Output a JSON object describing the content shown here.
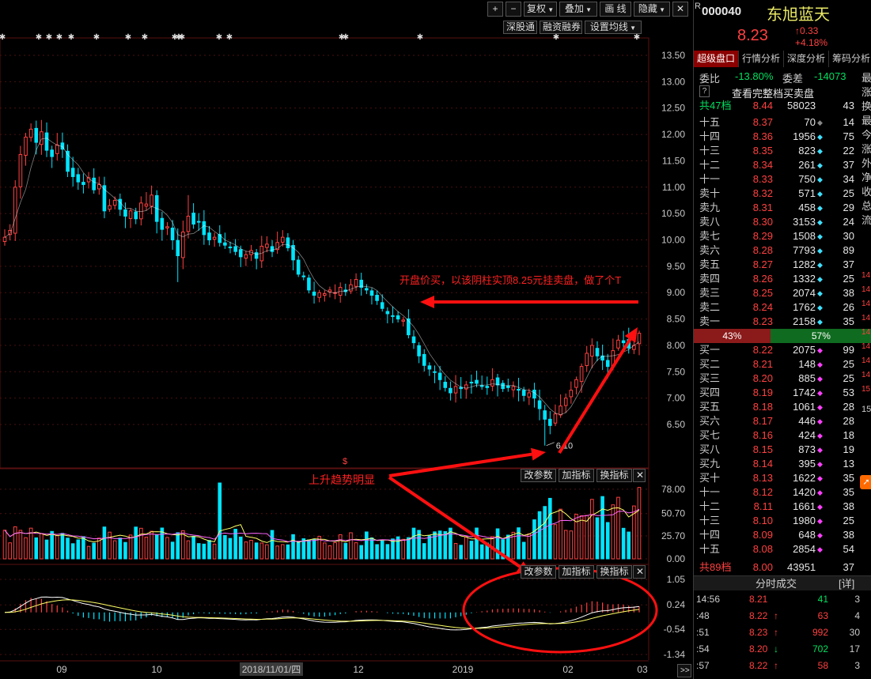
{
  "toolbar": {
    "plus": "+",
    "minus": "−",
    "restore": "复权",
    "overlay": "叠加",
    "draw": "画 线",
    "hide": "隐藏",
    "close": "✕",
    "sgt": "深股通",
    "margin": "融资融券",
    "ma_settings": "设置均线"
  },
  "markers": {
    "star_label": "✱",
    "dollar": "$"
  },
  "chart_data": [
    {
      "type": "candlestick",
      "y_ticks": [
        "13.50",
        "13.00",
        "12.50",
        "12.00",
        "11.50",
        "11.00",
        "10.50",
        "10.00",
        "9.50",
        "9.00",
        "8.50",
        "8.00",
        "7.50",
        "7.00",
        "6.50"
      ],
      "ylim": [
        6.1,
        13.5
      ],
      "low_label": "6.10",
      "x_ticks": [
        "09",
        "10",
        "2018/11/01/四",
        "12",
        "2019",
        "02",
        "03"
      ],
      "series": [
        {
          "name": "daily",
          "values": [
            10.05,
            10.18,
            11.0,
            11.62,
            11.95,
            12.1,
            11.85,
            12.05,
            11.7,
            11.58,
            11.8,
            11.72,
            11.3,
            11.2,
            11.1,
            11.05,
            11.18,
            10.95,
            11.05,
            10.55,
            10.65,
            10.75,
            10.58,
            10.45,
            10.55,
            10.4,
            10.7,
            10.68,
            10.85,
            10.35,
            10.2,
            10.25,
            10.0,
            9.7,
            10.15,
            10.45,
            10.3,
            10.35,
            10.1,
            10.0,
            10.05,
            9.95,
            9.9,
            9.85,
            9.78,
            9.68,
            9.72,
            9.8,
            9.65,
            9.88,
            9.92,
            9.78,
            9.95,
            10.05,
            9.85,
            9.62,
            9.35,
            9.3,
            9.05,
            8.95,
            9.0,
            8.98,
            9.05,
            9.0,
            9.1,
            9.02,
            9.15,
            9.25,
            9.1,
            9.05,
            8.95,
            8.85,
            8.7,
            8.6,
            8.55,
            8.5,
            8.48,
            8.2,
            8.05,
            7.8,
            7.62,
            7.55,
            7.5,
            7.35,
            7.2,
            7.1,
            7.22,
            7.18,
            7.25,
            7.3,
            7.28,
            7.22,
            7.2,
            7.35,
            7.25,
            7.18,
            7.2,
            7.22,
            7.15,
            7.05,
            7.1,
            7.0,
            6.8,
            6.6,
            6.48,
            6.7,
            6.85,
            7.0,
            7.15,
            7.35,
            7.6,
            7.85,
            8.0,
            7.8,
            7.72,
            7.6,
            7.9,
            8.1,
            8.05,
            7.95,
            8.0,
            8.23
          ]
        }
      ]
    },
    {
      "type": "bar",
      "y_ticks": [
        "78.00",
        "50.70",
        "25.70",
        "0.00"
      ],
      "ylim": [
        0,
        85
      ]
    },
    {
      "type": "bar",
      "y_ticks": [
        "1.05",
        "0.24",
        "-0.54",
        "-1.34"
      ],
      "ylim": [
        -1.34,
        1.05
      ]
    }
  ],
  "annotations": {
    "note_t": "开盘价买，以该阴柱实顶8.25元挂卖盘，做了个T",
    "trend": "上升趋势明显"
  },
  "subpanel_buttons": {
    "params": "改参数",
    "add": "加指标",
    "swap": "换指标",
    "close": "✕"
  },
  "nav": {
    "scroll_right": ">>"
  },
  "quote": {
    "code": "000040",
    "r_mark": "R",
    "name": "东旭蓝天",
    "price": "8.23",
    "change": "↑0.33",
    "pct": "+4.18%"
  },
  "tabs": [
    "超级盘口",
    "行情分析",
    "深度分析",
    "筹码分析"
  ],
  "weibi": {
    "label": "委比",
    "ratio": "-13.80%",
    "diff_label": "委差",
    "diff": "-14073"
  },
  "full_book": {
    "help": "?",
    "label": "查看完整档买卖盘"
  },
  "asks_total": {
    "label": "共47档",
    "price": "8.44",
    "vol": "58023",
    "cnt": "43"
  },
  "asks": [
    {
      "label": "十五",
      "price": "8.37",
      "vol": "70",
      "cnt": "14"
    },
    {
      "label": "十四",
      "price": "8.36",
      "vol": "1956",
      "cnt": "75"
    },
    {
      "label": "十三",
      "price": "8.35",
      "vol": "823",
      "cnt": "22"
    },
    {
      "label": "十二",
      "price": "8.34",
      "vol": "261",
      "cnt": "37"
    },
    {
      "label": "十一",
      "price": "8.33",
      "vol": "750",
      "cnt": "34"
    },
    {
      "label": "卖十",
      "price": "8.32",
      "vol": "571",
      "cnt": "25"
    },
    {
      "label": "卖九",
      "price": "8.31",
      "vol": "458",
      "cnt": "29"
    },
    {
      "label": "卖八",
      "price": "8.30",
      "vol": "3153",
      "cnt": "24"
    },
    {
      "label": "卖七",
      "price": "8.29",
      "vol": "1508",
      "cnt": "30"
    },
    {
      "label": "卖六",
      "price": "8.28",
      "vol": "7793",
      "cnt": "89"
    },
    {
      "label": "卖五",
      "price": "8.27",
      "vol": "1282",
      "cnt": "37"
    },
    {
      "label": "卖四",
      "price": "8.26",
      "vol": "1332",
      "cnt": "25"
    },
    {
      "label": "卖三",
      "price": "8.25",
      "vol": "2074",
      "cnt": "38"
    },
    {
      "label": "卖二",
      "price": "8.24",
      "vol": "1762",
      "cnt": "26"
    },
    {
      "label": "卖一",
      "price": "8.23",
      "vol": "2158",
      "cnt": "35"
    }
  ],
  "ratio_bar": {
    "left": "43%",
    "right": "57%"
  },
  "bids": [
    {
      "label": "买一",
      "price": "8.22",
      "vol": "2075",
      "cnt": "99"
    },
    {
      "label": "买二",
      "price": "8.21",
      "vol": "148",
      "cnt": "25"
    },
    {
      "label": "买三",
      "price": "8.20",
      "vol": "885",
      "cnt": "25"
    },
    {
      "label": "买四",
      "price": "8.19",
      "vol": "1742",
      "cnt": "53"
    },
    {
      "label": "买五",
      "price": "8.18",
      "vol": "1061",
      "cnt": "28"
    },
    {
      "label": "买六",
      "price": "8.17",
      "vol": "446",
      "cnt": "28"
    },
    {
      "label": "买七",
      "price": "8.16",
      "vol": "424",
      "cnt": "18"
    },
    {
      "label": "买八",
      "price": "8.15",
      "vol": "873",
      "cnt": "19"
    },
    {
      "label": "买九",
      "price": "8.14",
      "vol": "395",
      "cnt": "13"
    },
    {
      "label": "买十",
      "price": "8.13",
      "vol": "1622",
      "cnt": "35"
    },
    {
      "label": "十一",
      "price": "8.12",
      "vol": "1420",
      "cnt": "35"
    },
    {
      "label": "十二",
      "price": "8.11",
      "vol": "1661",
      "cnt": "38"
    },
    {
      "label": "十三",
      "price": "8.10",
      "vol": "1980",
      "cnt": "25"
    },
    {
      "label": "十四",
      "price": "8.09",
      "vol": "648",
      "cnt": "38"
    },
    {
      "label": "十五",
      "price": "8.08",
      "vol": "2854",
      "cnt": "54"
    }
  ],
  "bids_total": {
    "label": "共89档",
    "price": "8.00",
    "vol": "43951",
    "cnt": "37"
  },
  "trades_header": {
    "label": "分时成交",
    "detail": "[详]"
  },
  "trades": [
    {
      "time": "14:56",
      "price": "8.21",
      "arrow": "",
      "vol": "41",
      "cnt": "3"
    },
    {
      "time": ":48",
      "price": "8.22",
      "arrow": "↑",
      "vol": "63",
      "cnt": "4"
    },
    {
      "time": ":51",
      "price": "8.23",
      "arrow": "↑",
      "vol": "992",
      "cnt": "30"
    },
    {
      "time": ":54",
      "price": "8.20",
      "arrow": "↓",
      "vol": "702",
      "cnt": "17"
    },
    {
      "time": ":57",
      "price": "8.22",
      "arrow": "↑",
      "vol": "58",
      "cnt": "3"
    }
  ],
  "edge_labels": [
    "最",
    "涨",
    "换",
    "最",
    "今",
    "涨",
    "外",
    "净",
    "收",
    "总",
    "流"
  ],
  "edge_nums": [
    "14",
    "14",
    "14",
    "14",
    "14",
    "14",
    "14",
    "14",
    "15"
  ],
  "edge_vol": "15",
  "colors": {
    "up": "#ff4040",
    "down": "#00e5ff",
    "ma": "#ffff66",
    "ma2": "#ff66ff",
    "text": "#c8c8c8"
  }
}
